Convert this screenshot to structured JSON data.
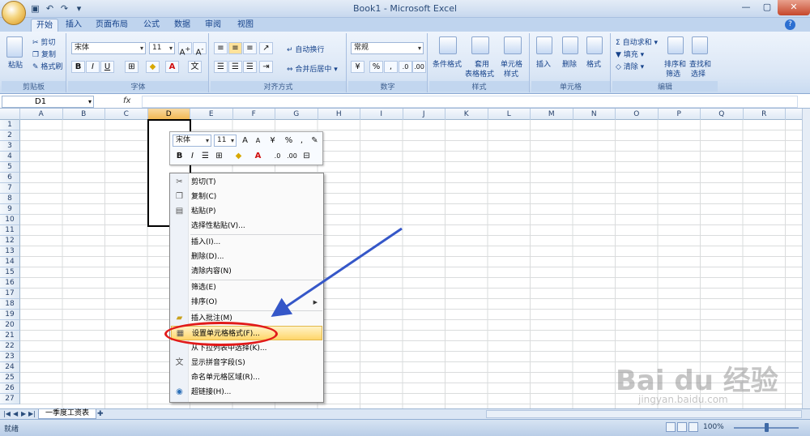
{
  "window": {
    "title": "Book1 - Microsoft Excel"
  },
  "tabs": [
    "开始",
    "插入",
    "页面布局",
    "公式",
    "数据",
    "审阅",
    "视图"
  ],
  "ribbon": {
    "clipboard": {
      "paste": "粘贴",
      "cut": "剪切",
      "copy": "复制",
      "format_painter": "格式刷",
      "label": "剪贴板"
    },
    "font": {
      "name": "宋体",
      "size": "11",
      "bold": "B",
      "italic": "I",
      "underline": "U",
      "label": "字体"
    },
    "alignment": {
      "wrap": "自动换行",
      "merge": "合并后居中",
      "label": "对齐方式"
    },
    "number": {
      "format": "常规",
      "percent": "%",
      "comma": ",",
      "label": "数字"
    },
    "styles": {
      "conditional": "条件格式",
      "table_format_1": "套用",
      "table_format_2": "表格格式",
      "cell_styles_1": "单元格",
      "cell_styles_2": "样式",
      "label": "样式"
    },
    "cells": {
      "insert": "插入",
      "delete": "删除",
      "format": "格式",
      "label": "单元格"
    },
    "editing": {
      "autosum": "自动求和",
      "fill": "填充",
      "clear": "清除",
      "sort_1": "排序和",
      "sort_2": "筛选",
      "find_1": "查找和",
      "find_2": "选择",
      "label": "编辑"
    }
  },
  "formula_bar": {
    "name_box": "D1",
    "fx": "fx"
  },
  "columns": [
    "A",
    "B",
    "C",
    "D",
    "E",
    "F",
    "G",
    "H",
    "I",
    "J",
    "K",
    "L",
    "M",
    "N",
    "O",
    "P",
    "Q",
    "R"
  ],
  "rows": [
    "1",
    "2",
    "3",
    "4",
    "5",
    "6",
    "7",
    "8",
    "9",
    "10",
    "11",
    "12",
    "13",
    "14",
    "15",
    "16",
    "17",
    "18",
    "19",
    "20",
    "21",
    "22",
    "23",
    "24",
    "25",
    "26",
    "27"
  ],
  "mini_toolbar": {
    "font": "宋体",
    "size": "11",
    "percent": "%",
    "comma": ",",
    "bold": "B",
    "italic": "I"
  },
  "context_menu": {
    "items": [
      {
        "label": "剪切(T)",
        "icon": "scissors-icon"
      },
      {
        "label": "复制(C)",
        "icon": "copy-icon"
      },
      {
        "label": "粘贴(P)",
        "icon": "paste-icon"
      },
      {
        "label": "选择性粘贴(V)..."
      },
      {
        "label": "插入(I)..."
      },
      {
        "label": "删除(D)..."
      },
      {
        "label": "清除内容(N)"
      },
      {
        "label": "筛选(E)"
      },
      {
        "label": "排序(O)"
      },
      {
        "label": "插入批注(M)",
        "icon": "comment-icon"
      },
      {
        "label": "设置单元格格式(F)...",
        "icon": "format-cells-icon"
      },
      {
        "label": "从下拉列表中选择(K)..."
      },
      {
        "label": "显示拼音字段(S)",
        "icon": "phonetic-icon"
      },
      {
        "label": "命名单元格区域(R)..."
      },
      {
        "label": "超链接(H)...",
        "icon": "hyperlink-icon"
      }
    ]
  },
  "sheet_tabs": [
    "一季度工资表"
  ],
  "status": {
    "ready": "就绪",
    "zoom": "100%"
  },
  "watermark": {
    "logo": "Bai du 经验",
    "url": "jingyan.baidu.com"
  },
  "colors": {
    "accent": "#15428b",
    "highlight": "#ffd66a",
    "annotation": "#e11a1a",
    "arrow": "#3557c8"
  }
}
